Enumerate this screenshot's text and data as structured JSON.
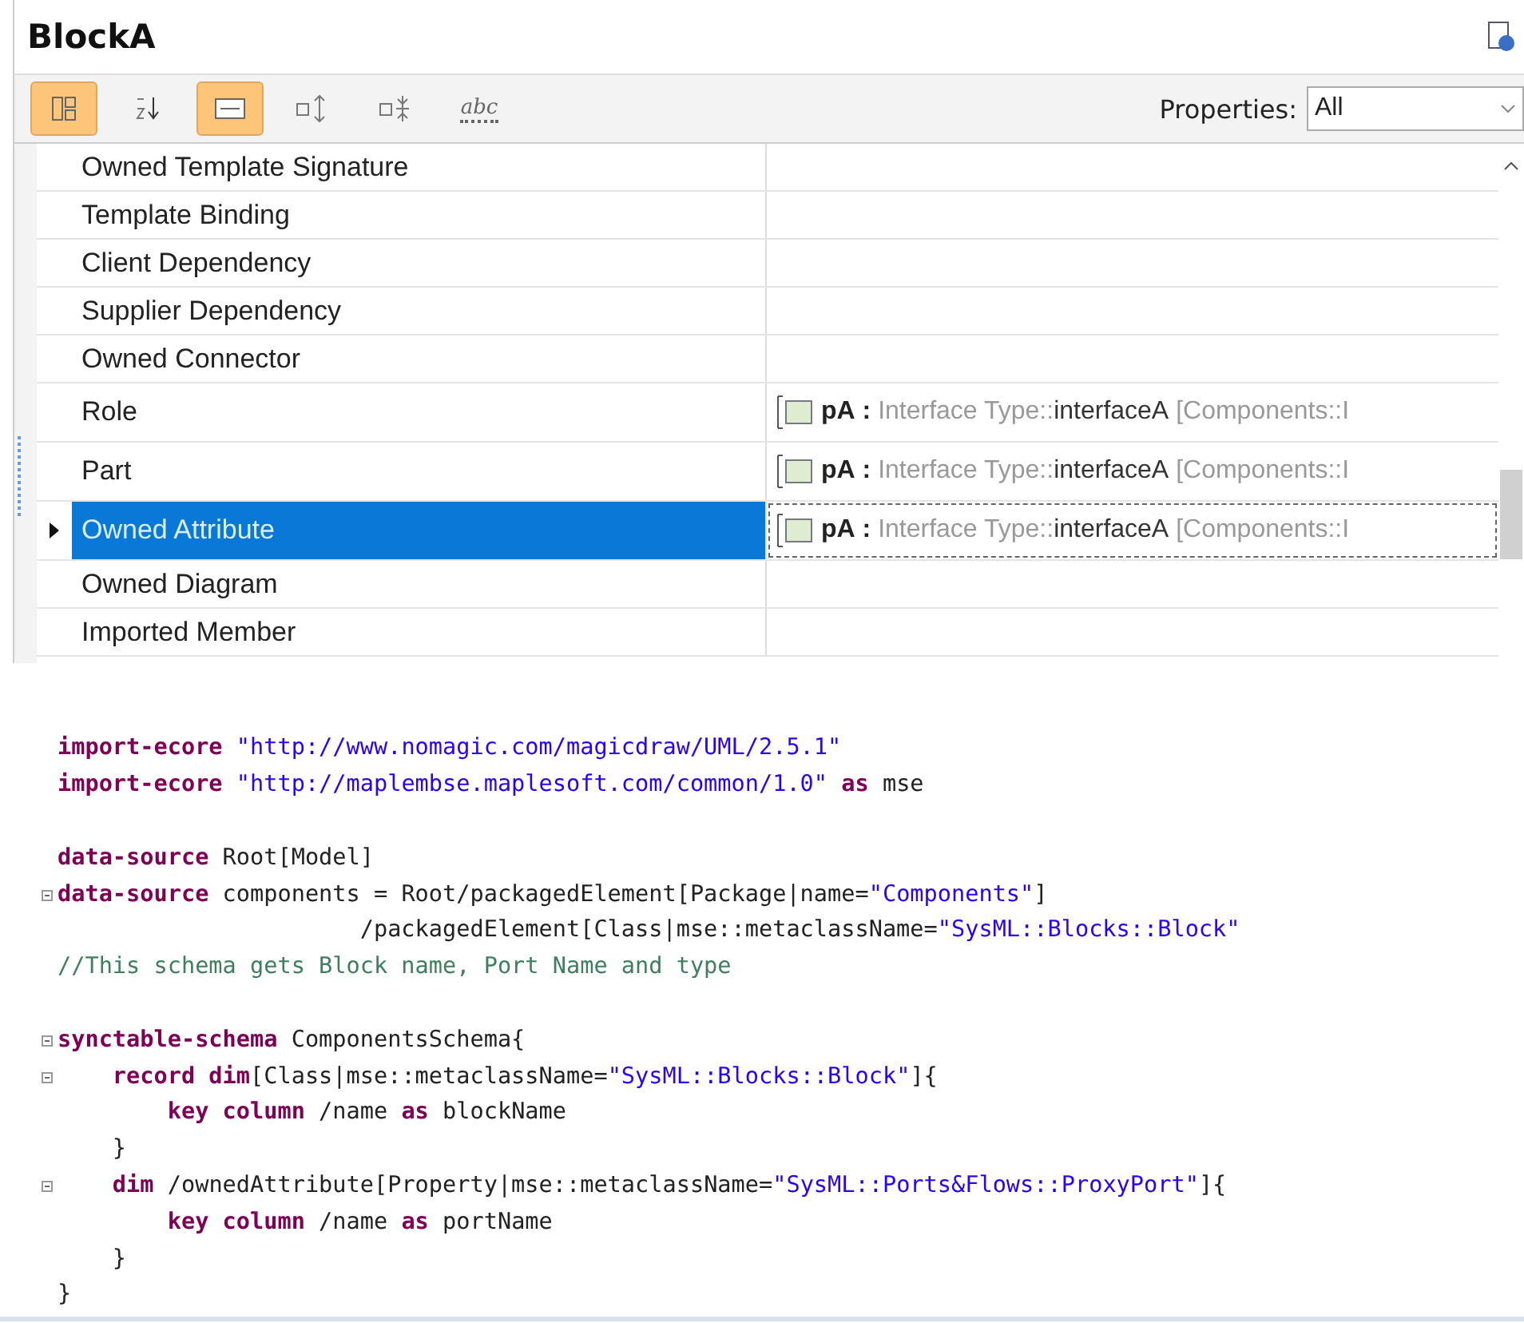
{
  "panel": {
    "title": "BlockA",
    "toolbar": [
      {
        "kind": "grouped",
        "active": true
      },
      {
        "kind": "sort",
        "active": false
      },
      {
        "kind": "compact",
        "active": true
      },
      {
        "kind": "expand",
        "active": false
      },
      {
        "kind": "collapse",
        "active": false
      },
      {
        "kind": "text",
        "label": "abc",
        "active": false
      }
    ],
    "filter": {
      "label": "Properties:",
      "value": "All"
    },
    "rows": [
      {
        "name": "Owned Template Signature",
        "selected": false
      },
      {
        "name": "Template Binding",
        "selected": false
      },
      {
        "name": "Client Dependency",
        "selected": false
      },
      {
        "name": "Supplier Dependency",
        "selected": false
      },
      {
        "name": "Owned Connector",
        "selected": false
      },
      {
        "name": "Role",
        "selected": false,
        "value": {
          "name": "pA",
          "sep": ":",
          "type_prefix": "Interface Type::",
          "type_name": "interfaceA",
          "owner": "[Components::I"
        }
      },
      {
        "name": "Part",
        "selected": false,
        "value": {
          "name": "pA",
          "sep": ":",
          "type_prefix": "Interface Type::",
          "type_name": "interfaceA",
          "owner": "[Components::I"
        }
      },
      {
        "name": "Owned Attribute",
        "selected": true,
        "value": {
          "name": "pA",
          "sep": ":",
          "type_prefix": "Interface Type::",
          "type_name": "interfaceA",
          "owner": "[Components::I"
        }
      },
      {
        "name": "Owned Diagram",
        "selected": false
      },
      {
        "name": "Imported Member",
        "selected": false
      }
    ]
  },
  "code": {
    "blocks": [
      {
        "lines": [
          {
            "fold": false,
            "tokens": [
              {
                "kind": "kw",
                "text": "import-ecore"
              },
              {
                "kind": "str",
                "text": " \"http://www.nomagic.com/magicdraw/UML/2.5.1\""
              }
            ]
          },
          {
            "fold": false,
            "tokens": [
              {
                "kind": "kw",
                "text": "import-ecore"
              },
              {
                "kind": "str",
                "text": " \"http://maplembse.maplesoft.com/common/1.0\""
              },
              {
                "kind": "kw",
                "text": " as"
              },
              {
                "kind": "plain",
                "text": " mse"
              }
            ]
          }
        ]
      },
      {
        "lines": [
          {
            "fold": false,
            "tokens": [
              {
                "kind": "kw",
                "text": "data-source"
              },
              {
                "kind": "plain",
                "text": " Root[Model]"
              }
            ]
          },
          {
            "fold": true,
            "tokens": [
              {
                "kind": "kw",
                "text": "data-source"
              },
              {
                "kind": "plain",
                "text": " components = Root/packagedElement[Package|name="
              },
              {
                "kind": "str",
                "text": "\"Components\""
              },
              {
                "kind": "plain",
                "text": "]"
              }
            ]
          },
          {
            "fold": false,
            "tokens": [
              {
                "kind": "plain",
                "text": "                      /packagedElement[Class|mse::metaclassName="
              },
              {
                "kind": "str",
                "text": "\"SysML::Blocks::Block\""
              }
            ]
          },
          {
            "fold": false,
            "tokens": [
              {
                "kind": "comment",
                "text": "//This schema gets Block name, Port Name and type"
              }
            ]
          }
        ]
      },
      {
        "lines": [
          {
            "fold": true,
            "tokens": [
              {
                "kind": "kw",
                "text": "synctable-schema"
              },
              {
                "kind": "plain",
                "text": " ComponentsSchema{"
              }
            ]
          },
          {
            "fold": true,
            "tokens": [
              {
                "kind": "kw",
                "text": "    record dim"
              },
              {
                "kind": "plain",
                "text": "[Class|mse::metaclassName="
              },
              {
                "kind": "str",
                "text": "\"SysML::Blocks::Block\""
              },
              {
                "kind": "plain",
                "text": "]{"
              }
            ]
          },
          {
            "fold": false,
            "tokens": [
              {
                "kind": "kw",
                "text": "        key column"
              },
              {
                "kind": "plain",
                "text": " /name"
              },
              {
                "kind": "kw",
                "text": " as"
              },
              {
                "kind": "plain",
                "text": " blockName"
              }
            ]
          },
          {
            "fold": false,
            "tokens": [
              {
                "kind": "plain",
                "text": "    }"
              }
            ]
          },
          {
            "fold": true,
            "tokens": [
              {
                "kind": "kw",
                "text": "    dim"
              },
              {
                "kind": "plain",
                "text": " /ownedAttribute[Property|mse::metaclassName="
              },
              {
                "kind": "str",
                "text": "\"SysML::Ports&Flows::ProxyPort\""
              },
              {
                "kind": "plain",
                "text": "]{"
              }
            ]
          },
          {
            "fold": false,
            "tokens": [
              {
                "kind": "kw",
                "text": "        key column"
              },
              {
                "kind": "plain",
                "text": " /name"
              },
              {
                "kind": "kw",
                "text": " as"
              },
              {
                "kind": "plain",
                "text": " portName"
              }
            ]
          },
          {
            "fold": false,
            "tokens": [
              {
                "kind": "plain",
                "text": "    }"
              }
            ]
          },
          {
            "fold": false,
            "tokens": [
              {
                "kind": "plain",
                "text": "}"
              }
            ]
          }
        ]
      }
    ]
  }
}
